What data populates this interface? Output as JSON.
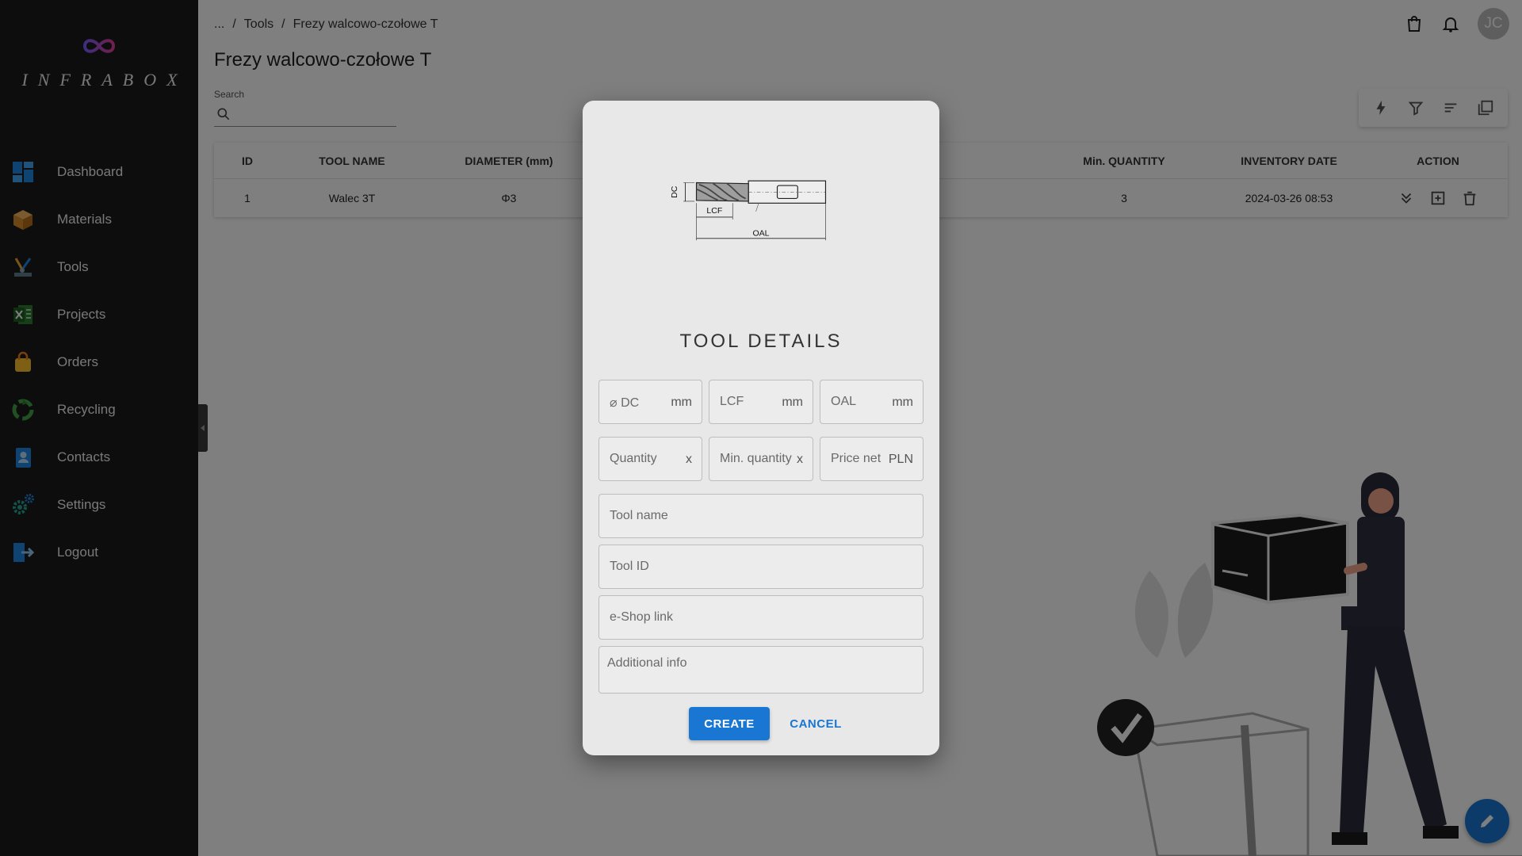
{
  "app": {
    "logo_text": "INFRABOX"
  },
  "sidebar": {
    "items": [
      {
        "label": "Dashboard",
        "icon": "dashboard-icon"
      },
      {
        "label": "Materials",
        "icon": "box-icon"
      },
      {
        "label": "Tools",
        "icon": "tools-icon"
      },
      {
        "label": "Projects",
        "icon": "spreadsheet-icon"
      },
      {
        "label": "Orders",
        "icon": "shopping-bag-icon"
      },
      {
        "label": "Recycling",
        "icon": "recycle-icon"
      },
      {
        "label": "Contacts",
        "icon": "contacts-icon"
      },
      {
        "label": "Settings",
        "icon": "gears-icon"
      },
      {
        "label": "Logout",
        "icon": "logout-icon"
      }
    ]
  },
  "header": {
    "breadcrumb": [
      "...",
      "/",
      "Tools",
      "/",
      "Frezy walcowo-czołowe T"
    ],
    "title": "Frezy walcowo-czołowe T",
    "avatar_initials": "JC"
  },
  "search": {
    "label": "Search"
  },
  "table": {
    "columns": [
      "ID",
      "TOOL NAME",
      "DIAMETER (mm)",
      "Min. QUANTITY",
      "INVENTORY DATE",
      "ACTION"
    ],
    "rows": [
      {
        "id": "1",
        "tool_name": "Walec 3T",
        "diameter": "Φ3",
        "min_quantity": "3",
        "inventory_date": "2024-03-26 08:53"
      }
    ]
  },
  "dialog": {
    "diagram_labels": {
      "dc": "DC",
      "lcf": "LCF",
      "oal": "OAL"
    },
    "title": "TOOL DETAILS",
    "fields": {
      "dc": {
        "placeholder": "⌀ DC",
        "suffix": "mm"
      },
      "lcf": {
        "placeholder": "LCF",
        "suffix": "mm"
      },
      "oal": {
        "placeholder": "OAL",
        "suffix": "mm"
      },
      "quantity": {
        "placeholder": "Quantity",
        "suffix": "x"
      },
      "min_quantity": {
        "placeholder": "Min. quantity",
        "suffix": "x"
      },
      "price_net": {
        "placeholder": "Price net",
        "suffix": "PLN"
      },
      "tool_name": {
        "placeholder": "Tool name"
      },
      "tool_id": {
        "placeholder": "Tool ID"
      },
      "eshop_link": {
        "placeholder": "e-Shop link"
      },
      "additional_info": {
        "placeholder": "Additional info"
      }
    },
    "create_label": "CREATE",
    "cancel_label": "CANCEL"
  },
  "colors": {
    "primary": "#1976d2",
    "sidebar_bg": "#1b1b1b",
    "overlay": "rgba(0,0,0,0.5)"
  }
}
